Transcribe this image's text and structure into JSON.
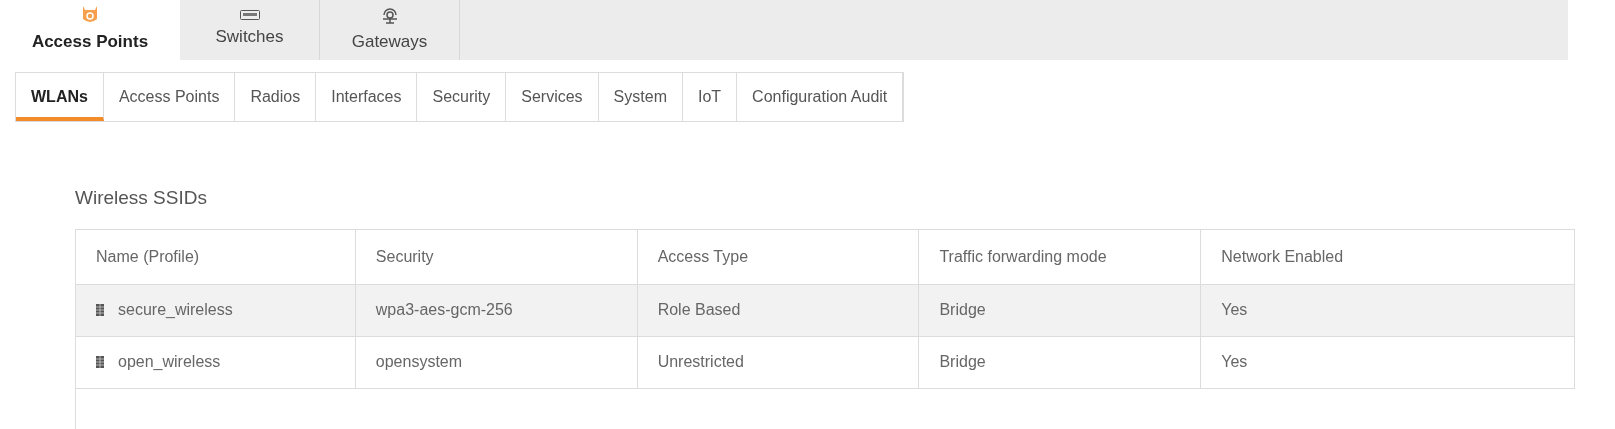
{
  "device_tabs": [
    {
      "label": "Access Points",
      "selected": true
    },
    {
      "label": "Switches",
      "selected": false
    },
    {
      "label": "Gateways",
      "selected": false
    }
  ],
  "sub_tabs": [
    {
      "label": "WLANs",
      "selected": true
    },
    {
      "label": "Access Points",
      "selected": false
    },
    {
      "label": "Radios",
      "selected": false
    },
    {
      "label": "Interfaces",
      "selected": false
    },
    {
      "label": "Security",
      "selected": false
    },
    {
      "label": "Services",
      "selected": false
    },
    {
      "label": "System",
      "selected": false
    },
    {
      "label": "IoT",
      "selected": false
    },
    {
      "label": "Configuration Audit",
      "selected": false
    }
  ],
  "section_title": "Wireless SSIDs",
  "table": {
    "columns": [
      "Name (Profile)",
      "Security",
      "Access Type",
      "Traffic forwarding mode",
      "Network Enabled"
    ],
    "rows": [
      {
        "selected": true,
        "cells": [
          "secure_wireless",
          "wpa3-aes-gcm-256",
          "Role Based",
          "Bridge",
          "Yes"
        ]
      },
      {
        "selected": false,
        "cells": [
          "open_wireless",
          "opensystem",
          "Unrestricted",
          "Bridge",
          "Yes"
        ]
      }
    ]
  }
}
